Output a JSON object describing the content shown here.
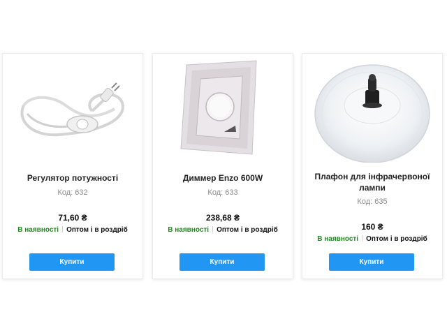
{
  "colors": {
    "accent": "#2196f3",
    "in_stock": "#1e8a1e"
  },
  "products": [
    {
      "title": "Регулятор потужності",
      "code": "Код: 632",
      "price": "71,60 ₴",
      "availability": "В наявності",
      "sale_type": "Оптом і в роздріб",
      "buy_label": "Купити",
      "image": "power-regulator-cord"
    },
    {
      "title": "Диммер Enzo 600W",
      "code": "Код: 633",
      "price": "238,68 ₴",
      "availability": "В наявності",
      "sale_type": "Оптом і в роздріб",
      "buy_label": "Купити",
      "image": "dimmer-switch"
    },
    {
      "title": "Плафон для інфрачервоної лампи",
      "code": "Код: 635",
      "price": "160 ₴",
      "availability": "В наявності",
      "sale_type": "Оптом і в роздріб",
      "buy_label": "Купити",
      "image": "lamp-shade"
    }
  ]
}
